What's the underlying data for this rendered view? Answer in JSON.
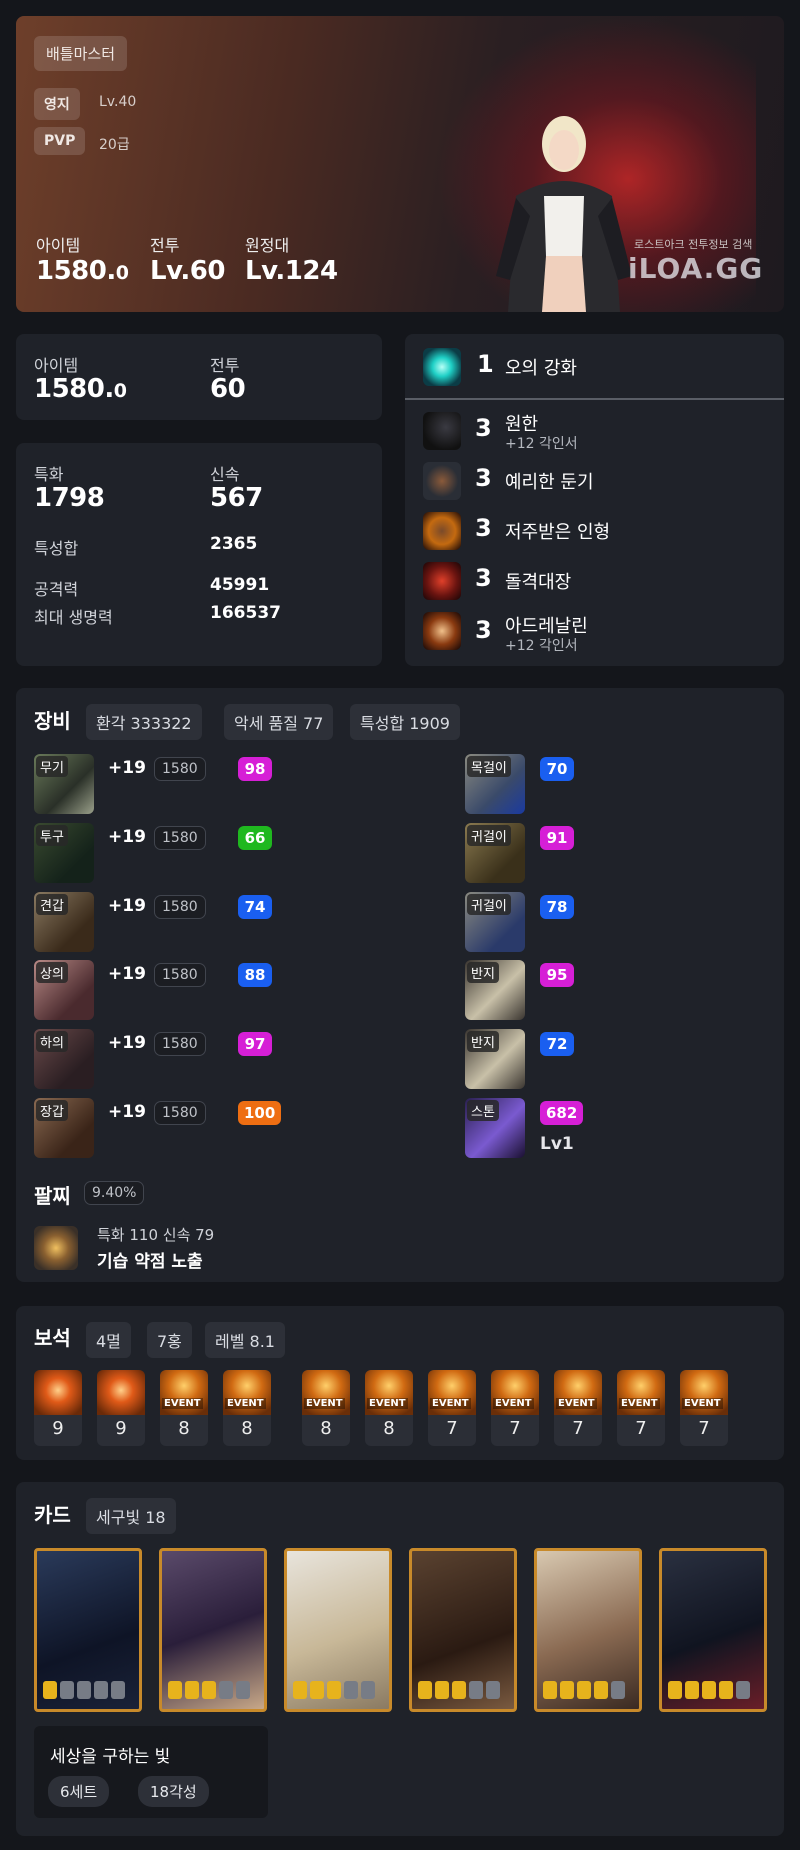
{
  "profile": {
    "class_name": "배틀마스터",
    "estate_label": "영지",
    "estate_value": "Lv.40",
    "pvp_label": "PVP",
    "pvp_value": "20급",
    "item_label": "아이템",
    "item_value_main": "1580.",
    "item_value_dec": "0",
    "combat_label": "전투",
    "combat_value": "Lv.60",
    "roster_label": "원정대",
    "roster_value": "Lv.124",
    "watermark_sub": "로스트아크 전투정보 검색",
    "watermark_logo": "iLOA.GG"
  },
  "summary": {
    "item_label": "아이템",
    "item_value_main": "1580.",
    "item_value_dec": "0",
    "combat_label": "전투",
    "combat_value": "60"
  },
  "stats": {
    "crit_label": "특화",
    "crit_value": "1798",
    "swift_label": "신속",
    "swift_value": "567",
    "total_label": "특성합",
    "total_value": "2365",
    "atk_label": "공격력",
    "atk_value": "45991",
    "hp_label": "최대 생명력",
    "hp_value": "166537"
  },
  "engravings": {
    "class": {
      "level": "1",
      "name": "오의 강화"
    },
    "list": [
      {
        "level": "3",
        "name": "원한",
        "sub": "+12 각인서"
      },
      {
        "level": "3",
        "name": "예리한 둔기",
        "sub": ""
      },
      {
        "level": "3",
        "name": "저주받은 인형",
        "sub": ""
      },
      {
        "level": "3",
        "name": "돌격대장",
        "sub": ""
      },
      {
        "level": "3",
        "name": "아드레날린",
        "sub": "+12 각인서"
      }
    ]
  },
  "equipment": {
    "title": "장비",
    "chips": [
      "환각 333322",
      "악세 품질 77",
      "특성합 1909"
    ],
    "armor": [
      {
        "slot": "무기",
        "honing": "+19",
        "ilvl": "1580",
        "quality": "98",
        "color": "#d61fd6"
      },
      {
        "slot": "투구",
        "honing": "+19",
        "ilvl": "1580",
        "quality": "66",
        "color": "#1fb81f"
      },
      {
        "slot": "견갑",
        "honing": "+19",
        "ilvl": "1580",
        "quality": "74",
        "color": "#1a5ff0"
      },
      {
        "slot": "상의",
        "honing": "+19",
        "ilvl": "1580",
        "quality": "88",
        "color": "#1a5ff0"
      },
      {
        "slot": "하의",
        "honing": "+19",
        "ilvl": "1580",
        "quality": "97",
        "color": "#d61fd6"
      },
      {
        "slot": "장갑",
        "honing": "+19",
        "ilvl": "1580",
        "quality": "100",
        "color": "#ee6e12"
      }
    ],
    "accessories": [
      {
        "slot": "목걸이",
        "quality": "70",
        "color": "#1a5ff0"
      },
      {
        "slot": "귀걸이",
        "quality": "91",
        "color": "#d61fd6"
      },
      {
        "slot": "귀걸이",
        "quality": "78",
        "color": "#1a5ff0"
      },
      {
        "slot": "반지",
        "quality": "95",
        "color": "#d61fd6"
      },
      {
        "slot": "반지",
        "quality": "72",
        "color": "#1a5ff0"
      },
      {
        "slot": "스톤",
        "quality": "682",
        "color": "#d61fd6"
      }
    ],
    "stone_level": "Lv1"
  },
  "bracelet": {
    "title": "팔찌",
    "percent": "9.40%",
    "stats": "특화 110  신속 79",
    "effects": "기습  약점 노출"
  },
  "gems": {
    "title": "보석",
    "chips": [
      "4멸",
      "7홍",
      "레벨 8.1"
    ],
    "event_label": "EVENT",
    "items": [
      {
        "level": "9",
        "event": false
      },
      {
        "level": "9",
        "event": false
      },
      {
        "level": "8",
        "event": true
      },
      {
        "level": "8",
        "event": true
      },
      {
        "level": "8",
        "event": true
      },
      {
        "level": "8",
        "event": true
      },
      {
        "level": "7",
        "event": true
      },
      {
        "level": "7",
        "event": true
      },
      {
        "level": "7",
        "event": true
      },
      {
        "level": "7",
        "event": true
      },
      {
        "level": "7",
        "event": true
      }
    ]
  },
  "cards": {
    "title": "카드",
    "chip": "세구빛 18",
    "items": [
      {
        "awakened": 1
      },
      {
        "awakened": 3
      },
      {
        "awakened": 3
      },
      {
        "awakened": 3
      },
      {
        "awakened": 4
      },
      {
        "awakened": 4
      }
    ],
    "set_name": "세상을 구하는 빛",
    "set_chips": [
      "6세트",
      "18각성"
    ]
  },
  "colors": {
    "background": "#14161b",
    "panel": "#1f2229",
    "quality_purple": "#d61fd6",
    "quality_blue": "#1a5ff0",
    "quality_green": "#1fb81f",
    "quality_orange": "#ee6e12"
  }
}
